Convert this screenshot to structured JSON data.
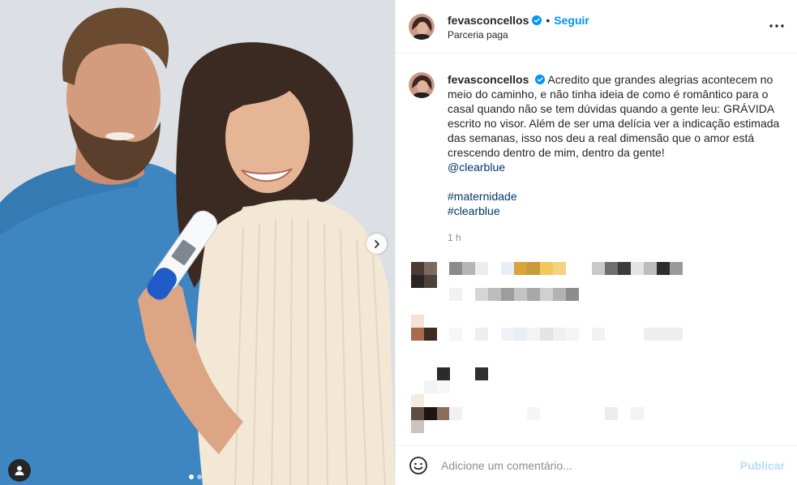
{
  "post": {
    "username": "fevasconcellos",
    "follow_label": "Seguir",
    "separator": "•",
    "subtitle": "Parceria paga",
    "caption_text": "Acredito que grandes alegrias acontecem no meio do caminho, e não tinha ideia de como é romântico para o casal quando não se tem dúvidas quando a gente leu: GRÁVIDA escrito no visor. Além de ser uma delícia ver a indicação estimada das semanas, isso nos deu a real dimensão que o amor está crescendo dentro de mim, dentro da gente!",
    "mention": "@clearblue",
    "hashtags": [
      "#maternidade",
      "#clearblue"
    ],
    "time": "1 h"
  },
  "media": {
    "current_slide": 1,
    "slide_count": 2
  },
  "composer": {
    "placeholder": "Adicione um comentário...",
    "post_label": "Publicar"
  },
  "icons": {
    "verified": "verified-badge-icon",
    "more": "more-options-icon",
    "next": "chevron-right-icon",
    "user_tags": "user-tag-icon",
    "emoji": "emoji-icon"
  },
  "colors": {
    "accent": "#0095f6",
    "link": "#00376b",
    "muted": "#8e8e8e",
    "post_disabled": "#b2dffc"
  }
}
